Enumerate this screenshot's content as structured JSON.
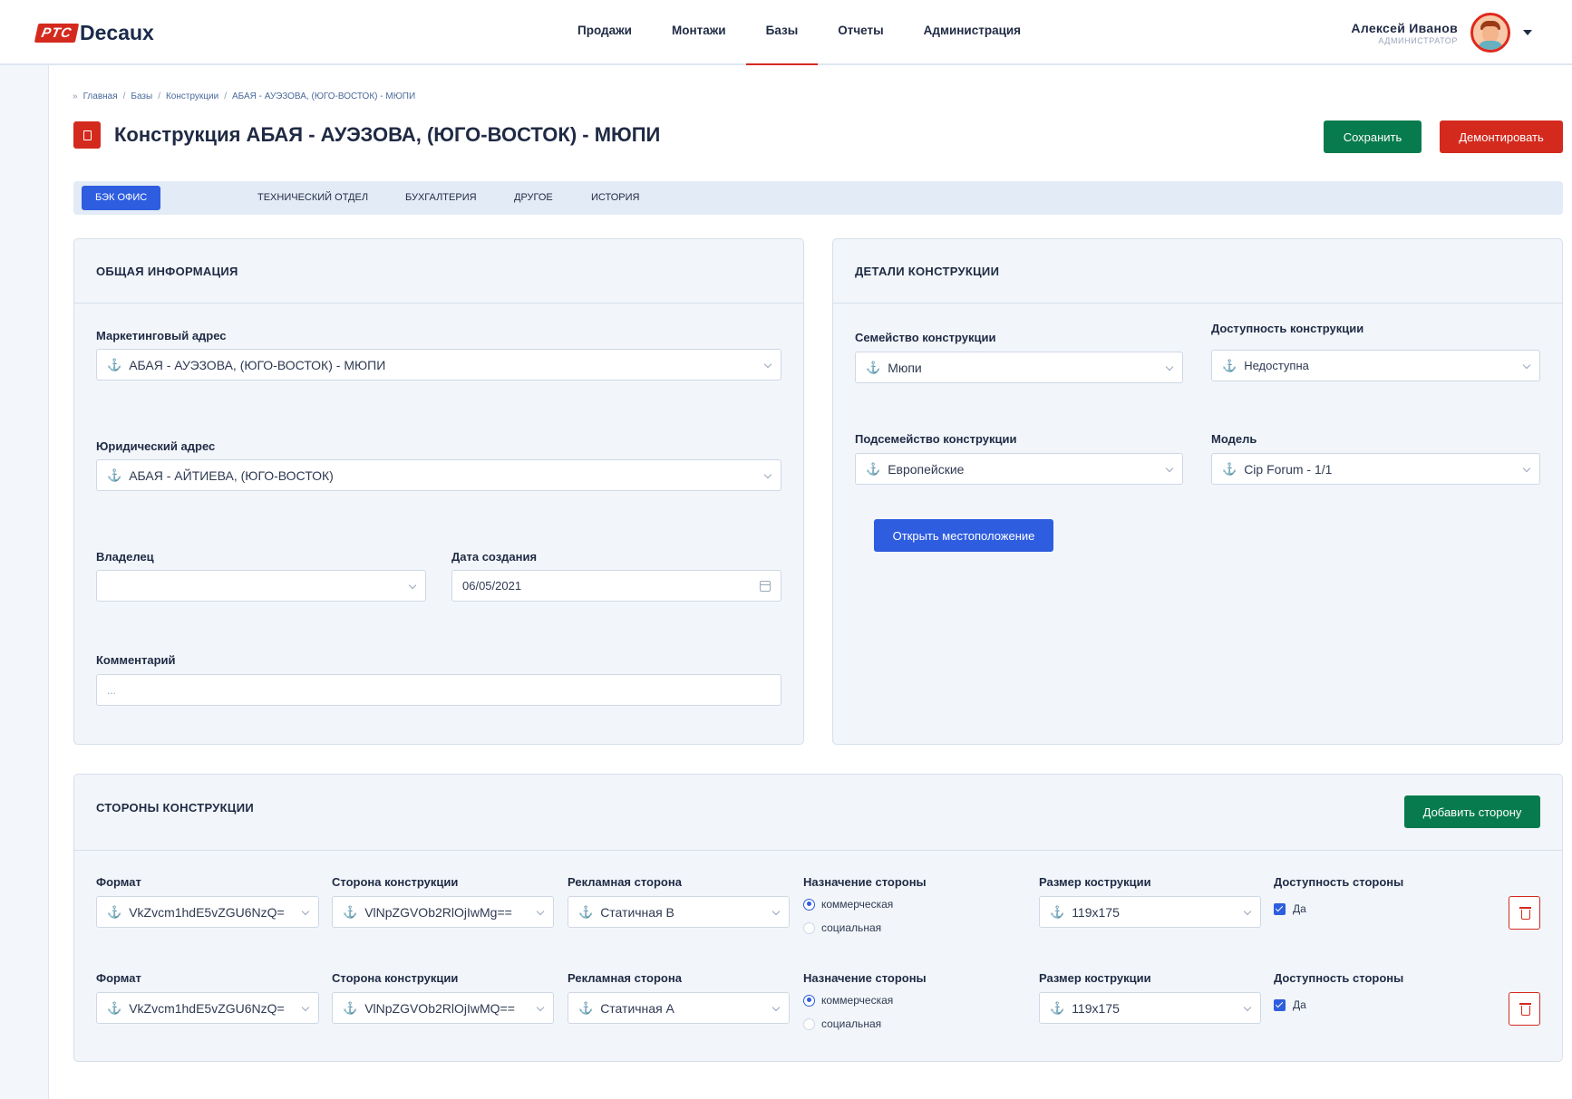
{
  "brand": {
    "badge": "PTC",
    "name": "Decaux"
  },
  "nav": [
    {
      "label": "Продажи"
    },
    {
      "label": "Монтажи"
    },
    {
      "label": "Базы"
    },
    {
      "label": "Отчеты"
    },
    {
      "label": "Администрация"
    }
  ],
  "user": {
    "name": "Алексей Иванов",
    "role": "АДМИНИСТРАТОР"
  },
  "breadcrumb": [
    "»",
    "Главная",
    "/",
    "Базы",
    "/",
    "Конструкции",
    "/",
    "АБАЯ - АУЭЗОВА, (ЮГО-ВОСТОК) - МЮПИ"
  ],
  "page": {
    "title": "Конструкция АБАЯ - АУЭЗОВА, (ЮГО-ВОСТОК) - МЮПИ"
  },
  "actions": {
    "save": "Сохранить",
    "dismantle": "Демонтировать"
  },
  "tabs": [
    {
      "label": "БЭК ОФИС"
    },
    {
      "label": "ТЕХНИЧЕСКИЙ ОТДЕЛ"
    },
    {
      "label": "БУХГАЛТЕРИЯ"
    },
    {
      "label": "ДРУГОЕ"
    },
    {
      "label": "ИСТОРИЯ"
    }
  ],
  "general": {
    "title": "ОБЩАЯ ИНФОРМАЦИЯ",
    "marketing_label": "Маркетинговый адрес",
    "marketing_value": "АБАЯ - АУЭЗОВА, (ЮГО-ВОСТОК) - МЮПИ",
    "legal_label": "Юридический адрес",
    "legal_value": "АБАЯ - АЙТИЕВА, (ЮГО-ВОСТОК)",
    "owner_label": "Владелец",
    "owner_value": "",
    "date_label": "Дата создания",
    "date_value": "06/05/2021",
    "comment_label": "Комментарий",
    "comment_placeholder": "..."
  },
  "details": {
    "title": "ДЕТАЛИ КОНСТРУКЦИИ",
    "family_label": "Семейство конструкции",
    "family_value": "Мюпи",
    "availability_label": "Доступность конструкции",
    "availability_value": "Недоступна",
    "subfamily_label": "Подсемейство конструкции",
    "subfamily_value": "Европейские",
    "model_label": "Модель",
    "model_value": "Cip Forum - 1/1",
    "open_location": "Открыть местоположение"
  },
  "sides": {
    "title": "СТОРОНЫ КОНСТРУКЦИИ",
    "add_button": "Добавить сторону",
    "labels": {
      "format": "Формат",
      "side": "Сторона конструкции",
      "ad_side": "Рекламная сторона",
      "purpose": "Назначение стороны",
      "size": "Размер кострукции",
      "availability": "Доступность стороны"
    },
    "purpose_options": [
      "коммерческая",
      "социальная"
    ],
    "rows": [
      {
        "format": "VkZvcm1hdE5vZGU6NzQ=",
        "side": "VlNpZGVOb2RlOjIwMg==",
        "ad_side": "Статичная B",
        "purpose": "коммерческая",
        "size": "119x175",
        "available": "Да"
      },
      {
        "format": "VkZvcm1hdE5vZGU6NzQ=",
        "side": "VlNpZGVOb2RlOjIwMQ==",
        "ad_side": "Статичная А",
        "purpose": "коммерческая",
        "size": "119x175",
        "available": "Да"
      }
    ]
  }
}
